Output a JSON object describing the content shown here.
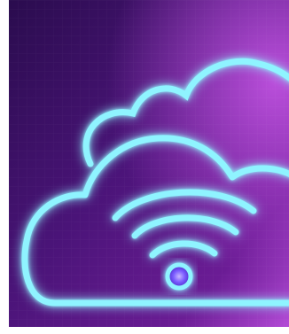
{
  "image": {
    "subject": "neon-cloud-wifi",
    "colors": {
      "background_dark": "#2a0c4e",
      "background_mid": "#5a1a86",
      "background_light": "#b34ad6",
      "neon_cyan": "#8ff4ff",
      "neon_core": "#e9ffff",
      "wifi_dot": "#7a5cff"
    }
  }
}
